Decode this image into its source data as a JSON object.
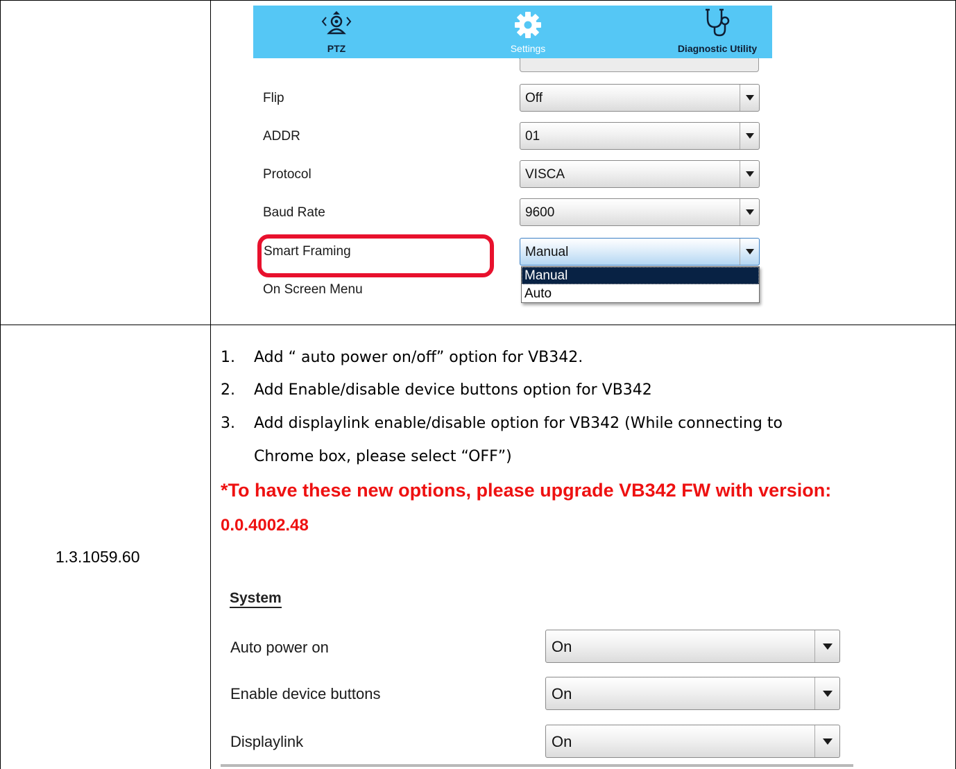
{
  "nav": {
    "items": [
      {
        "label": "PTZ",
        "icon": "ptz-camera-icon"
      },
      {
        "label": "Settings",
        "icon": "gear-icon"
      },
      {
        "label": "Diagnostic Utility",
        "icon": "stethoscope-icon"
      }
    ],
    "color": "#55c7f5"
  },
  "camera_settings": [
    {
      "label": "Flip",
      "value": "Off"
    },
    {
      "label": "ADDR",
      "value": "01"
    },
    {
      "label": "Protocol",
      "value": "VISCA"
    },
    {
      "label": "Baud Rate",
      "value": "9600"
    },
    {
      "label": "Smart Framing",
      "value": "Manual"
    },
    {
      "label": "On Screen Menu"
    }
  ],
  "smart_framing_dropdown": {
    "options": [
      "Manual",
      "Auto"
    ],
    "selected": "Manual"
  },
  "highlight_color": "#e8112d",
  "version": "1.3.1059.60",
  "changes": [
    {
      "num": "1.",
      "text": "Add “ auto power on/off” option for VB342."
    },
    {
      "num": "2.",
      "text": "Add Enable/disable device buttons option for VB342"
    },
    {
      "num": "3.",
      "text": "Add displaylink enable/disable option for VB342 (While connecting to",
      "continuation": "Chrome box, please select “OFF”)"
    }
  ],
  "warning": {
    "line1": "*To have these new options, please upgrade VB342 FW with version:",
    "line2": "0.0.4002.48",
    "color": "#ee1111"
  },
  "system": {
    "heading": "System",
    "items": [
      {
        "label": "Auto power on",
        "value": "On"
      },
      {
        "label": "Enable device buttons",
        "value": "On"
      },
      {
        "label": "Displaylink",
        "value": "On"
      }
    ]
  }
}
